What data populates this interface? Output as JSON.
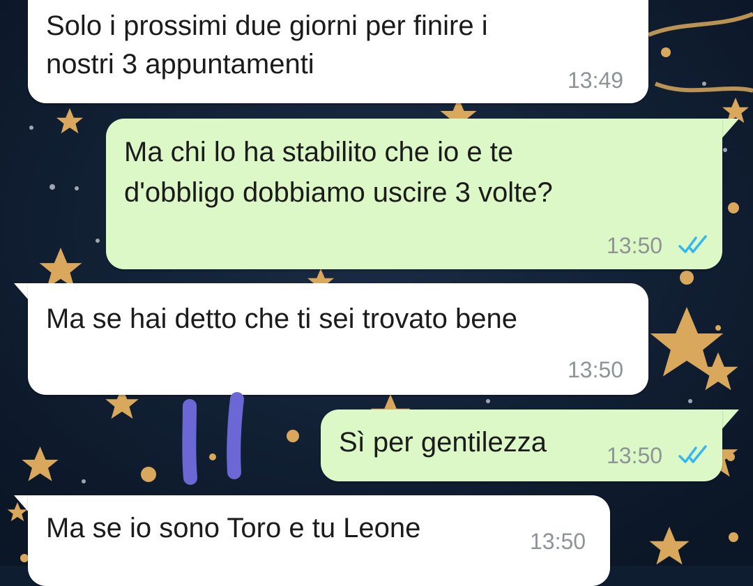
{
  "theme": {
    "wallpaper": "#0f1d30",
    "incoming_bubble": "#ffffff",
    "outgoing_bubble": "#dcf8c6",
    "read_ticks": "#34b7f1",
    "timestamp": "#8e9396",
    "scribble": "#6b67d4"
  },
  "messages": [
    {
      "direction": "incoming",
      "lines": [
        "Solo i prossimi due giorni per finire i",
        "nostri 3 appuntamenti"
      ],
      "time": "13:49"
    },
    {
      "direction": "outgoing",
      "lines": [
        "Ma chi lo ha stabilito che io e te",
        "d'obbligo dobbiamo uscire 3 volte?"
      ],
      "time": "13:50",
      "status": "read",
      "status_icon": "double-check-icon"
    },
    {
      "direction": "incoming",
      "lines": [
        "Ma se hai detto che ti sei trovato bene"
      ],
      "time": "13:50"
    },
    {
      "direction": "outgoing",
      "lines": [
        "Sì per gentilezza"
      ],
      "time": "13:50",
      "status": "read",
      "status_icon": "double-check-icon"
    },
    {
      "direction": "incoming",
      "lines": [
        "Ma se io sono Toro e tu Leone"
      ],
      "time": "13:50"
    }
  ]
}
